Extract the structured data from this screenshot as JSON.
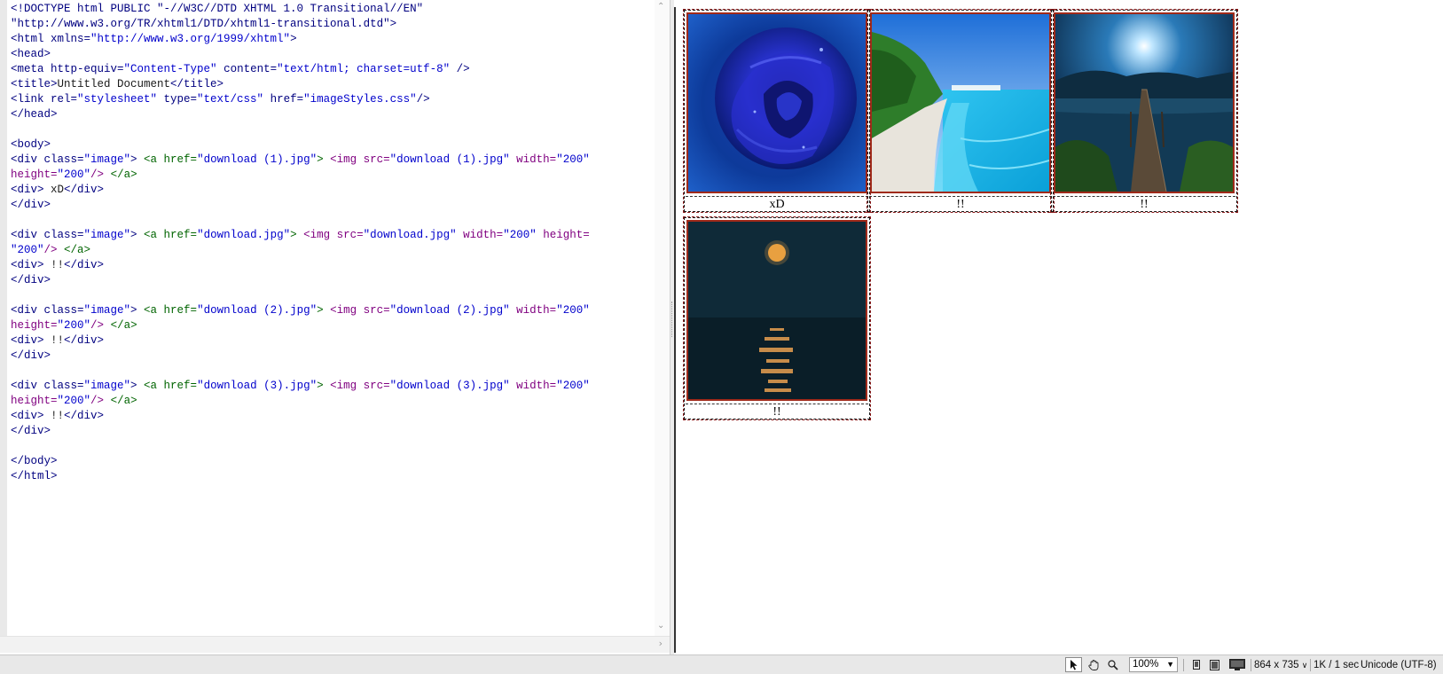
{
  "code": {
    "lines": [
      [
        [
          "c-doc",
          "<!DOCTYPE html PUBLIC \"-//W3C//DTD XHTML 1.0 Transitional//EN\""
        ]
      ],
      [
        [
          "c-doc",
          "\"http://www.w3.org/TR/xhtml1/DTD/xhtml1-transitional.dtd\">"
        ]
      ],
      [
        [
          "c-tag",
          "<html xmlns="
        ],
        [
          "c-str",
          "\"http://www.w3.org/1999/xhtml\""
        ],
        [
          "c-tag",
          ">"
        ]
      ],
      [
        [
          "c-tag",
          "<head>"
        ]
      ],
      [
        [
          "c-tag",
          "<meta http-equiv="
        ],
        [
          "c-str",
          "\"Content-Type\""
        ],
        [
          "c-tag",
          " content="
        ],
        [
          "c-str",
          "\"text/html; charset=utf-8\""
        ],
        [
          "c-tag",
          " />"
        ]
      ],
      [
        [
          "c-tag",
          "<title>"
        ],
        [
          "c-txt",
          "Untitled Document"
        ],
        [
          "c-tag",
          "</title>"
        ]
      ],
      [
        [
          "c-tag",
          "<link rel="
        ],
        [
          "c-str",
          "\"stylesheet\""
        ],
        [
          "c-tag",
          " type="
        ],
        [
          "c-str",
          "\"text/css\""
        ],
        [
          "c-tag",
          " href="
        ],
        [
          "c-str",
          "\"imageStyles.css\""
        ],
        [
          "c-tag",
          "/>"
        ]
      ],
      [
        [
          "c-tag",
          "</head>"
        ]
      ],
      [
        [
          "c-txt",
          ""
        ]
      ],
      [
        [
          "c-tag",
          "<body>"
        ]
      ],
      [
        [
          "c-tag",
          "<div class="
        ],
        [
          "c-str",
          "\"image\""
        ],
        [
          "c-tag",
          "> "
        ],
        [
          "c-a",
          "<a href="
        ],
        [
          "c-str",
          "\"download (1).jpg\""
        ],
        [
          "c-a",
          ">"
        ],
        [
          "c-txt",
          " "
        ],
        [
          "c-img",
          "<img src="
        ],
        [
          "c-str",
          "\"download (1).jpg\""
        ],
        [
          "c-img",
          " width="
        ],
        [
          "c-str",
          "\"200\""
        ]
      ],
      [
        [
          "c-img",
          "height="
        ],
        [
          "c-str",
          "\"200\""
        ],
        [
          "c-img",
          "/>"
        ],
        [
          "c-txt",
          " "
        ],
        [
          "c-a",
          "</a>"
        ]
      ],
      [
        [
          "c-tag",
          "<div>"
        ],
        [
          "c-txt",
          " xD"
        ],
        [
          "c-tag",
          "</div>"
        ]
      ],
      [
        [
          "c-tag",
          "</div>"
        ]
      ],
      [
        [
          "c-txt",
          ""
        ]
      ],
      [
        [
          "c-tag",
          "<div class="
        ],
        [
          "c-str",
          "\"image\""
        ],
        [
          "c-tag",
          "> "
        ],
        [
          "c-a",
          "<a href="
        ],
        [
          "c-str",
          "\"download.jpg\""
        ],
        [
          "c-a",
          ">"
        ],
        [
          "c-txt",
          " "
        ],
        [
          "c-img",
          "<img src="
        ],
        [
          "c-str",
          "\"download.jpg\""
        ],
        [
          "c-img",
          " width="
        ],
        [
          "c-str",
          "\"200\""
        ],
        [
          "c-img",
          " height="
        ]
      ],
      [
        [
          "c-str",
          "\"200\""
        ],
        [
          "c-img",
          "/>"
        ],
        [
          "c-txt",
          " "
        ],
        [
          "c-a",
          "</a>"
        ]
      ],
      [
        [
          "c-tag",
          "<div>"
        ],
        [
          "c-txt",
          " !!"
        ],
        [
          "c-tag",
          "</div>"
        ]
      ],
      [
        [
          "c-tag",
          "</div>"
        ]
      ],
      [
        [
          "c-txt",
          ""
        ]
      ],
      [
        [
          "c-tag",
          "<div class="
        ],
        [
          "c-str",
          "\"image\""
        ],
        [
          "c-tag",
          "> "
        ],
        [
          "c-a",
          "<a href="
        ],
        [
          "c-str",
          "\"download (2).jpg\""
        ],
        [
          "c-a",
          ">"
        ],
        [
          "c-txt",
          " "
        ],
        [
          "c-img",
          "<img src="
        ],
        [
          "c-str",
          "\"download (2).jpg\""
        ],
        [
          "c-img",
          " width="
        ],
        [
          "c-str",
          "\"200\""
        ]
      ],
      [
        [
          "c-img",
          "height="
        ],
        [
          "c-str",
          "\"200\""
        ],
        [
          "c-img",
          "/>"
        ],
        [
          "c-txt",
          " "
        ],
        [
          "c-a",
          "</a>"
        ]
      ],
      [
        [
          "c-tag",
          "<div>"
        ],
        [
          "c-txt",
          " !!"
        ],
        [
          "c-tag",
          "</div>"
        ]
      ],
      [
        [
          "c-tag",
          "</div>"
        ]
      ],
      [
        [
          "c-txt",
          ""
        ]
      ],
      [
        [
          "c-tag",
          "<div class="
        ],
        [
          "c-str",
          "\"image\""
        ],
        [
          "c-tag",
          "> "
        ],
        [
          "c-a",
          "<a href="
        ],
        [
          "c-str",
          "\"download (3).jpg\""
        ],
        [
          "c-a",
          ">"
        ],
        [
          "c-txt",
          " "
        ],
        [
          "c-img",
          "<img src="
        ],
        [
          "c-str",
          "\"download (3).jpg\""
        ],
        [
          "c-img",
          " width="
        ],
        [
          "c-str",
          "\"200\""
        ]
      ],
      [
        [
          "c-img",
          "height="
        ],
        [
          "c-str",
          "\"200\""
        ],
        [
          "c-img",
          "/>"
        ],
        [
          "c-txt",
          " "
        ],
        [
          "c-a",
          "</a>"
        ]
      ],
      [
        [
          "c-tag",
          "<div>"
        ],
        [
          "c-txt",
          " !!"
        ],
        [
          "c-tag",
          "</div>"
        ]
      ],
      [
        [
          "c-tag",
          "</div>"
        ]
      ],
      [
        [
          "c-txt",
          ""
        ]
      ],
      [
        [
          "c-tag",
          "</body>"
        ]
      ],
      [
        [
          "c-tag",
          "</html>"
        ]
      ]
    ]
  },
  "gallery": {
    "cards": [
      {
        "caption": "xD",
        "image": "blue-rose-photo"
      },
      {
        "caption": "!!",
        "image": "tropical-beach-photo"
      },
      {
        "caption": "!!",
        "image": "lake-pier-night-photo"
      },
      {
        "caption": "!!",
        "image": "moon-over-sea-photo"
      }
    ]
  },
  "statusbar": {
    "zoom": "100%",
    "dimensions": "864 x 735",
    "file_size": "1K / 1 sec",
    "encoding": "Unicode (UTF-8)",
    "icons": [
      "select-pointer-icon",
      "hand-tool-icon",
      "zoom-tool-icon",
      "mobile-size-icon",
      "tablet-size-icon",
      "desktop-size-icon"
    ]
  },
  "colors": {
    "tag": "#000080",
    "string": "#0000cc",
    "anchor": "#006400",
    "img_tag": "#800080",
    "card_border": "#8b1a1a"
  }
}
